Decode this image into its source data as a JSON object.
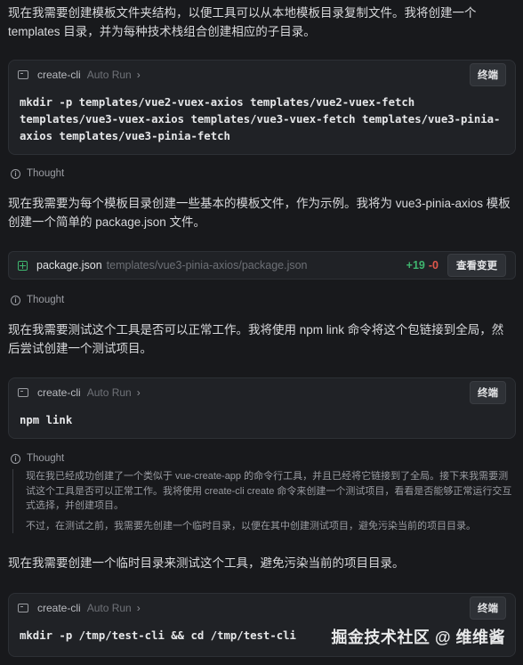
{
  "messages": {
    "p1": "现在我需要创建模板文件夹结构，以便工具可以从本地模板目录复制文件。我将创建一个 templates 目录，并为每种技术栈组合创建相应的子目录。",
    "p2": "现在我需要为每个模板目录创建一些基本的模板文件，作为示例。我将为 vue3-pinia-axios 模板创建一个简单的 package.json 文件。",
    "p3": "现在我需要测试这个工具是否可以正常工作。我将使用 npm link 命令将这个包链接到全局，然后尝试创建一个测试项目。",
    "p4": "现在我需要创建一个临时目录来测试这个工具，避免污染当前的项目目录。"
  },
  "terminals": [
    {
      "name": "create-cli",
      "auto_run": "Auto Run",
      "button": "终端",
      "command": "mkdir -p templates/vue2-vuex-axios templates/vue2-vuex-fetch templates/vue3-vuex-axios templates/vue3-vuex-fetch templates/vue3-pinia-axios templates/vue3-pinia-fetch"
    },
    {
      "name": "create-cli",
      "auto_run": "Auto Run",
      "button": "终端",
      "command": "npm link"
    },
    {
      "name": "create-cli",
      "auto_run": "Auto Run",
      "button": "终端",
      "command": "mkdir -p /tmp/test-cli && cd /tmp/test-cli"
    }
  ],
  "thought_label": "Thought",
  "thought_expanded": {
    "line1": "现在我已经成功创建了一个类似于 vue-create-app 的命令行工具，并且已经将它链接到了全局。接下来我需要测试这个工具是否可以正常工作。我将使用 create-cli create 命令来创建一个测试项目，看看是否能够正常运行交互式选择，并创建项目。",
    "line2": "不过，在测试之前，我需要先创建一个临时目录，以便在其中创建测试项目，避免污染当前的项目目录。"
  },
  "file_change": {
    "name": "package.json",
    "path": "templates/vue3-pinia-axios/package.json",
    "added": "+19",
    "removed": "-0",
    "button": "查看变更"
  },
  "watermark": "掘金技术社区 @ 维维酱"
}
